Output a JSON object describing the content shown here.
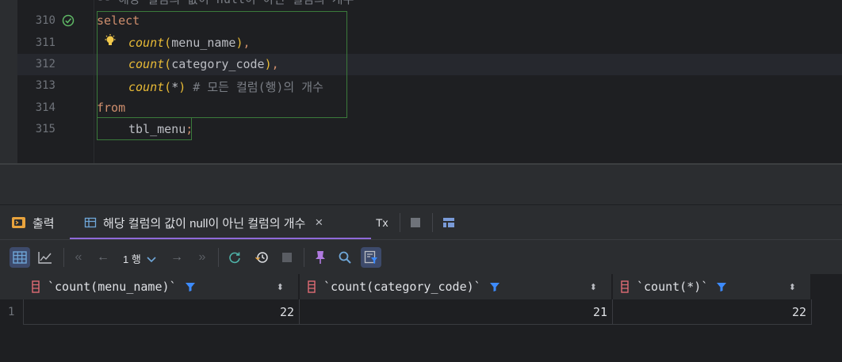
{
  "editor": {
    "line_309_partial": "-- 해당 컬럼의 값이 null이 아닌 컬럼의 개수",
    "lines": [
      {
        "num": "310",
        "text": "select"
      },
      {
        "num": "311",
        "fn": "count",
        "arg": "menu_name",
        "tail": ","
      },
      {
        "num": "312",
        "fn": "count",
        "arg": "category_code",
        "tail": ","
      },
      {
        "num": "313",
        "fn": "count",
        "arg": "*",
        "comment": "# 모든 컬럼(행)의 개수"
      },
      {
        "num": "314",
        "text": "from"
      },
      {
        "num": "315",
        "text": "tbl_menu",
        "tail": ";"
      }
    ]
  },
  "tabs": {
    "output_label": "출력",
    "result_label": "해당 컬럼의 값이 null이 아닌 컬럼의 개수",
    "close_glyph": "×",
    "tx_label": "Tx"
  },
  "toolbar": {
    "page_label": "1 행"
  },
  "grid": {
    "columns": [
      "`count(menu_name)`",
      "`count(category_code)`",
      "`count(*)`"
    ],
    "rows": [
      {
        "num": "1",
        "values": [
          "22",
          "21",
          "22"
        ]
      }
    ]
  },
  "colors": {
    "accent_purple": "#8f6ad9",
    "keyword": "#cf8e6d",
    "function": "#e8ba36",
    "filter_blue": "#3d8bfd",
    "column_icon_red": "#e06c75"
  }
}
